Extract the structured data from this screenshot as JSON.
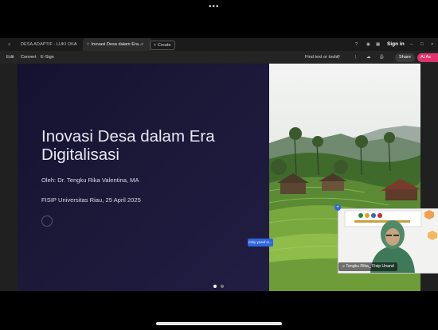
{
  "window": {
    "menu_dots": "•••"
  },
  "tabs": {
    "home_icon": "home-icon",
    "inactive_tab": "DESA ADAPTIF - LUKI OKA",
    "active_tab": "Inovasi Desa dalam Era...",
    "new_tab": "+ Create",
    "sign_in": "Sign in"
  },
  "toolbar": {
    "edit": "Edit",
    "convert": "Convert",
    "esign": "E-Sign",
    "find": "Find text or tools",
    "share": "Share",
    "ai": "AI As"
  },
  "slide": {
    "title": "Inovasi Desa dalam Era Digitalisasi",
    "author": "Oleh: Dr. Tengku Rika Valentina, MA",
    "date": "FISIP Universitas Riau, 25 April 2025",
    "current_page": 1,
    "total_pages": 2
  },
  "zoom_tag": "rizky yusuf rs...",
  "video": {
    "participant": "Tengku Rika_ Fisip Unand"
  },
  "colors": {
    "accent": "#2f66e0",
    "ai_button": "#e0336e",
    "slide_bg": "#1b1838"
  }
}
